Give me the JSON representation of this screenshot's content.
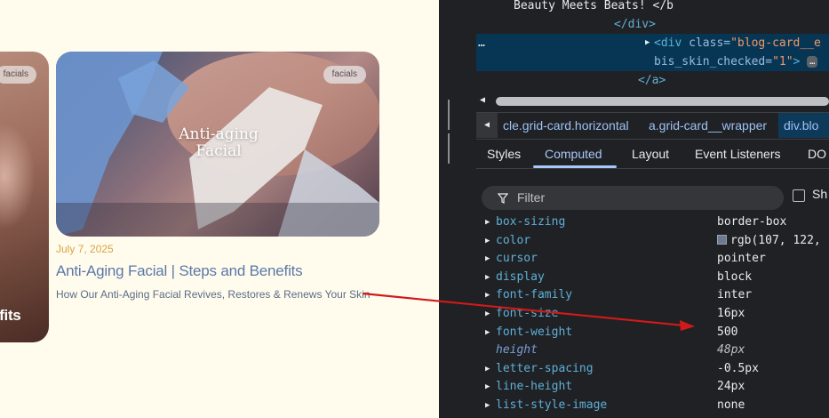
{
  "page": {
    "prev_card": {
      "tag": "facials",
      "overlay_title": "efits"
    },
    "card": {
      "tag": "facials",
      "image_title": "Anti-aging Facial",
      "date": "July 7, 2025",
      "title": "Anti-Aging Facial | Steps and Benefits",
      "excerpt": "How Our Anti-Aging Facial Revives, Restores & Renews Your Skin"
    }
  },
  "devtools": {
    "dom_lines": [
      {
        "text": "Beauty Meets Beats! </b",
        "kind": "text"
      },
      {
        "text": "</div>",
        "kind": "tag"
      },
      {
        "tag_open": "<div ",
        "attr": "class=",
        "val": "\"blog-card__e",
        "selected": true,
        "dots": "…"
      },
      {
        "attr2": "bis_skin_checked=",
        "val2": "\"1\"",
        "close": ">",
        "badge": "…"
      },
      {
        "text": "</a>",
        "kind": "tag"
      }
    ],
    "breadcrumbs": [
      {
        "label": "cle.grid-card.horizontal",
        "active": false
      },
      {
        "label": "a.grid-card__wrapper",
        "active": false
      },
      {
        "label": "div.blo",
        "active": true
      }
    ],
    "breadcrumb_back": "◀",
    "tabs": [
      {
        "label": "Styles",
        "active": false
      },
      {
        "label": "Computed",
        "active": true
      },
      {
        "label": "Layout",
        "active": false
      },
      {
        "label": "Event Listeners",
        "active": false
      },
      {
        "label": "DO",
        "active": false
      }
    ],
    "filter": {
      "placeholder": "Filter",
      "show_all_label": "Sh"
    },
    "properties": [
      {
        "name": "box-sizing",
        "value": "border-box",
        "expandable": true
      },
      {
        "name": "color",
        "value": "rgb(107, 122,",
        "expandable": true,
        "swatch": "#6b7a92"
      },
      {
        "name": "cursor",
        "value": "pointer",
        "expandable": true
      },
      {
        "name": "display",
        "value": "block",
        "expandable": true
      },
      {
        "name": "font-family",
        "value": "inter",
        "expandable": true
      },
      {
        "name": "font-size",
        "value": "16px",
        "expandable": true
      },
      {
        "name": "font-weight",
        "value": "500",
        "expandable": true
      },
      {
        "name": "height",
        "value": "48px",
        "expandable": false,
        "inherited": true
      },
      {
        "name": "letter-spacing",
        "value": "-0.5px",
        "expandable": true
      },
      {
        "name": "line-height",
        "value": "24px",
        "expandable": true
      },
      {
        "name": "list-style-image",
        "value": "none",
        "expandable": true
      }
    ]
  },
  "colors": {
    "page_bg": "#fffcee",
    "date": "#d9a441",
    "title": "#5b78a8",
    "excerpt": "#5b6c85",
    "annotation_arrow": "#d11a1a",
    "devtools_bg": "#202124"
  }
}
